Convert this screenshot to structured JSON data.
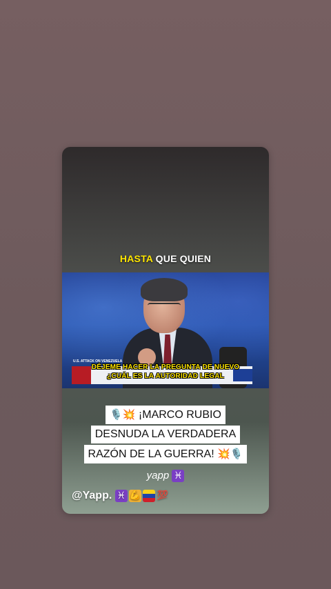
{
  "caption": {
    "highlight": "HASTA",
    "rest": " QUE QUIEN"
  },
  "video": {
    "subtitle_line1": "DÉJEME HACER LA PREGUNTA DE NUEVO",
    "subtitle_line2": "¿CUÁL ES LA AUTORIDAD LEGAL",
    "ticker_label": "U.S. ATTACK ON VENEZUELA"
  },
  "title": {
    "line1": "¡MARCO RUBIO",
    "line2": "DESNUDA LA VERDADERA",
    "line3": "RAZÓN DE LA GUERRA!",
    "lead_emojis": "🎙️💥",
    "trail_emojis": "💥🎙️"
  },
  "yapp_text": "yapp",
  "pisces_symbol": "♓",
  "handle": "@Yapp.",
  "handle_emojis": [
    "♓",
    "💪",
    "🇻🇪",
    "💯"
  ],
  "icons": [
    "microphone-icon",
    "explosion-icon",
    "pisces-icon",
    "flexed-bicep-icon",
    "venezuela-flag-icon",
    "hundred-points-icon"
  ]
}
